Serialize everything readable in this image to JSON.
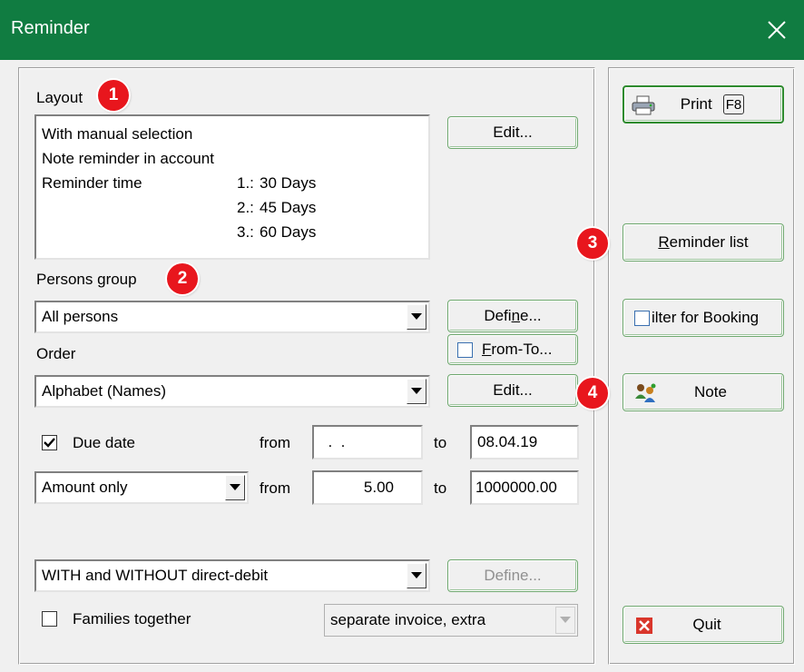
{
  "window": {
    "title": "Reminder",
    "title_bar_color": "#107c41"
  },
  "layout": {
    "label": "Layout",
    "lines": {
      "l1": "With manual selection",
      "l2": "Note reminder in account",
      "l3": "Reminder time"
    },
    "reminder_times": [
      {
        "num": "1.:",
        "days": "30 Days"
      },
      {
        "num": "2.:",
        "days": "45 Days"
      },
      {
        "num": "3.:",
        "days": "60 Days"
      }
    ],
    "edit_label": "Edit..."
  },
  "persons_group": {
    "label_pre": "Persons ",
    "label_key": "g",
    "label_post": "roup",
    "selected": "All persons",
    "define_pre": "Defi",
    "define_key": "n",
    "define_post": "e...",
    "fromto_key": "F",
    "fromto_post": "rom-To..."
  },
  "order": {
    "label": "Order",
    "selected": "Alphabet (Names)",
    "edit_label": "Edit..."
  },
  "due_date": {
    "label": "Due date",
    "checked": true,
    "from_label": "from",
    "from_value": "  .  .",
    "to_label": "to",
    "to_value": "08.04.19"
  },
  "amount": {
    "selected": "Amount only",
    "from_label": "from",
    "from_value": "5.00",
    "to_label": "to",
    "to_value": "1000000.00"
  },
  "direct_debit": {
    "selected": "WITH and WITHOUT direct-debit",
    "define_label": "Define..."
  },
  "families": {
    "label": "Families together",
    "checked": false,
    "invoice_selected": "separate invoice, extra"
  },
  "sidebar": {
    "print_label": "Print",
    "print_key": "F8",
    "reminder_list_key": "R",
    "reminder_list_post": "eminder list",
    "filter_label": "ilter for Booking",
    "note_label": "Note",
    "quit_label": "Quit"
  },
  "badges": [
    "1",
    "2",
    "3",
    "4"
  ],
  "colors": {
    "badge": "#e8161d",
    "button_border": "#6fa86f",
    "quit_icon": "#d9362b"
  },
  "icons": {
    "close": "close-icon",
    "dropdown": "chevron-down-icon",
    "print": "printer-icon",
    "note": "note-people-icon",
    "quit": "quit-x-icon"
  }
}
